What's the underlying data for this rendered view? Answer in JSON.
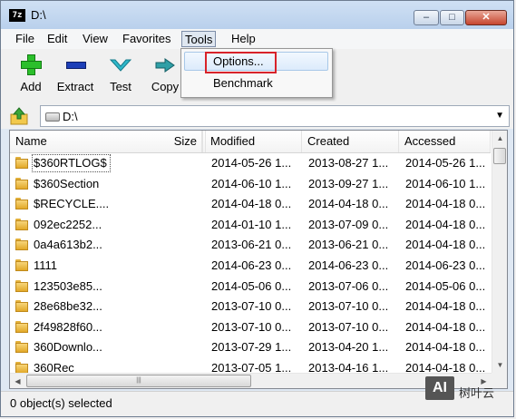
{
  "window": {
    "title": "D:\\",
    "app_icon_text": "7z",
    "controls": {
      "minimize": "–",
      "maximize": "□",
      "close": "✕"
    }
  },
  "menubar": {
    "items": [
      "File",
      "Edit",
      "View",
      "Favorites",
      "Tools",
      "Help"
    ],
    "active": "Tools"
  },
  "toolbar": {
    "items": [
      {
        "label": "Add",
        "icon": "add-plus-icon"
      },
      {
        "label": "Extract",
        "icon": "extract-minus-icon"
      },
      {
        "label": "Test",
        "icon": "test-check-icon"
      },
      {
        "label": "Copy",
        "icon": "copy-arrow-icon"
      }
    ]
  },
  "tools_menu": {
    "items": [
      "Options...",
      "Benchmark"
    ],
    "highlighted": "Options..."
  },
  "address": {
    "path": "D:\\"
  },
  "list": {
    "columns": [
      "Name",
      "Size",
      "Modified",
      "Created",
      "Accessed"
    ],
    "rows": [
      {
        "name": "$360RTLOG$",
        "size": "",
        "modified": "2014-05-26 1...",
        "created": "2013-08-27 1...",
        "accessed": "2014-05-26 1..."
      },
      {
        "name": "$360Section",
        "size": "",
        "modified": "2014-06-10 1...",
        "created": "2013-09-27 1...",
        "accessed": "2014-06-10 1..."
      },
      {
        "name": "$RECYCLE....",
        "size": "",
        "modified": "2014-04-18 0...",
        "created": "2014-04-18 0...",
        "accessed": "2014-04-18 0..."
      },
      {
        "name": "092ec2252...",
        "size": "",
        "modified": "2014-01-10 1...",
        "created": "2013-07-09 0...",
        "accessed": "2014-04-18 0..."
      },
      {
        "name": "0a4a613b2...",
        "size": "",
        "modified": "2013-06-21 0...",
        "created": "2013-06-21 0...",
        "accessed": "2014-04-18 0..."
      },
      {
        "name": "1111",
        "size": "",
        "modified": "2014-06-23 0...",
        "created": "2014-06-23 0...",
        "accessed": "2014-06-23 0..."
      },
      {
        "name": "123503e85...",
        "size": "",
        "modified": "2014-05-06 0...",
        "created": "2013-07-06 0...",
        "accessed": "2014-05-06 0..."
      },
      {
        "name": "28e68be32...",
        "size": "",
        "modified": "2013-07-10 0...",
        "created": "2013-07-10 0...",
        "accessed": "2014-04-18 0..."
      },
      {
        "name": "2f49828f60...",
        "size": "",
        "modified": "2013-07-10 0...",
        "created": "2013-07-10 0...",
        "accessed": "2014-04-18 0..."
      },
      {
        "name": "360Downlo...",
        "size": "",
        "modified": "2013-07-29 1...",
        "created": "2013-04-20 1...",
        "accessed": "2014-04-18 0..."
      },
      {
        "name": "360Rec",
        "size": "",
        "modified": "2013-07-05 1...",
        "created": "2013-04-16 1...",
        "accessed": "2014-04-18 0..."
      }
    ]
  },
  "status": {
    "text": "0 object(s) selected"
  },
  "watermark": {
    "logo": "AI",
    "text": "树叶云"
  },
  "colors": {
    "highlight_border": "#d8232a",
    "menu_active_bg": "#dfe7f1",
    "folder": "#f7d57a"
  }
}
